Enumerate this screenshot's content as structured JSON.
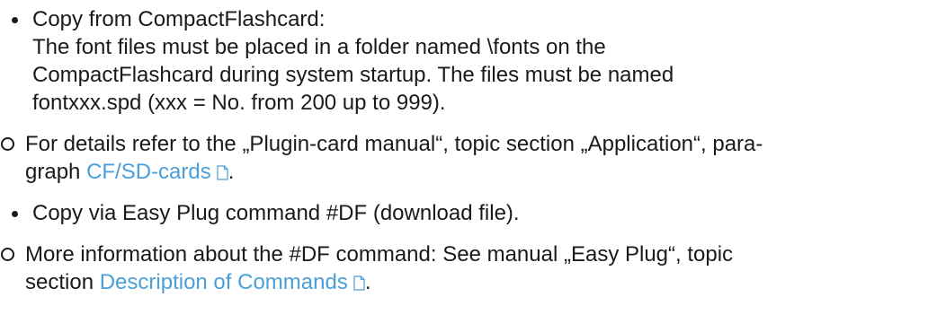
{
  "items": [
    {
      "type": "bullet",
      "lines": [
        "Copy from CompactFlashcard:",
        "The font files must be placed in a folder named \\fonts on the",
        "CompactFlashcard during system startup. The files must be named",
        "fontxxx.spd (xxx = No. from 200 up to 999)."
      ]
    },
    {
      "type": "circle",
      "line1": "For details refer to the „Plugin-card manual“, topic section „Application“, para-",
      "line2_prefix": "graph ",
      "link": "CF/SD-cards",
      "line2_suffix": "."
    },
    {
      "type": "bullet",
      "lines": [
        "Copy via Easy Plug command #DF (download file)."
      ]
    },
    {
      "type": "circle",
      "line1": "More information about the #DF command: See manual „Easy Plug“, topic",
      "line2_prefix": "section ",
      "link": "Description of Commands",
      "line2_suffix": "."
    }
  ],
  "link_color": "#4a9fd8",
  "icons": {
    "document": "document-link-icon"
  }
}
